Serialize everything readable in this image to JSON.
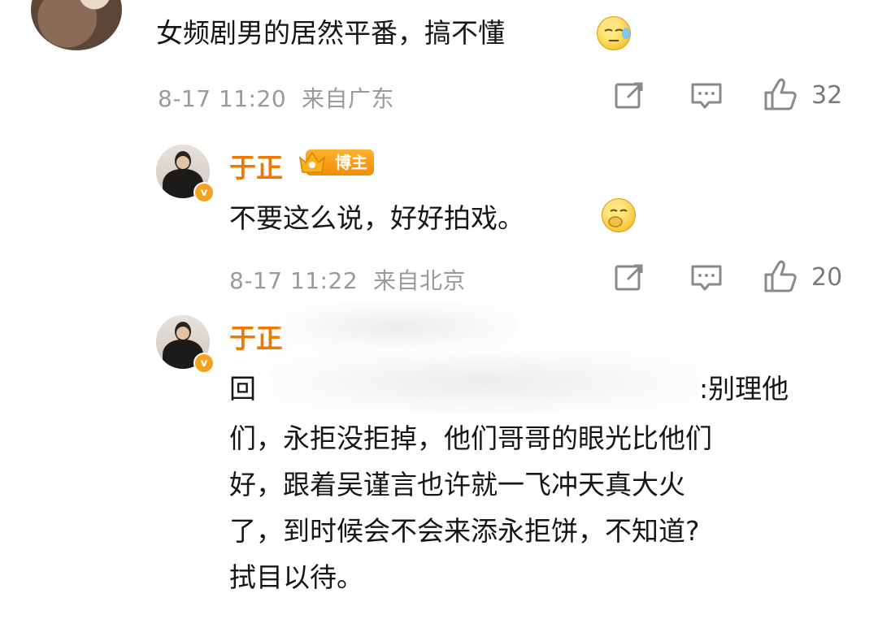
{
  "comments": [
    {
      "text": "女频剧男的居然平番，搞不懂",
      "emoji": "sleepy-sweat-emoji",
      "time": "8-17 11:20",
      "location": "来自广东",
      "likes": "32"
    },
    {
      "username": "于正",
      "badge_label": "博主",
      "text": "不要这么说，好好拍戏。",
      "emoji": "covering-mouth-emoji",
      "time": "8-17 11:22",
      "location": "来自北京",
      "likes": "20"
    },
    {
      "username": "于正",
      "reply_prefix": "回",
      "lines": [
        ":别理他",
        "们，永拒没拒掉，他们哥哥的眼光比他们",
        "好，跟着吴谨言也许就一飞冲天真大火",
        "了，到时候会不会来添永拒饼，不知道?",
        "拭目以待。"
      ]
    }
  ],
  "colors": {
    "username": "#ee7800",
    "meta": "#9a9a9a",
    "icon": "#8a8a8a",
    "badge": "#f5a623"
  }
}
